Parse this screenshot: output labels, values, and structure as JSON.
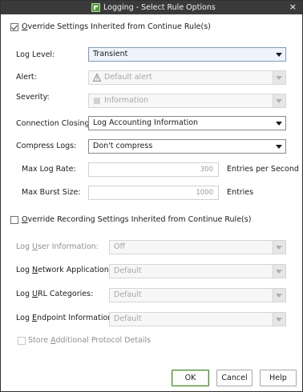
{
  "window": {
    "title": "Logging - Select Rule Options",
    "close_glyph": "×"
  },
  "override_settings": {
    "label_prefix": "O",
    "label_rest": "verride Settings Inherited from Continue Rule(s)",
    "checked": true
  },
  "log_level": {
    "label": "Log Level:",
    "value": "Transient"
  },
  "alert": {
    "label": "Alert:",
    "value": "Default alert",
    "icon": "warning-icon"
  },
  "severity": {
    "label": "Severity:",
    "value": "Information",
    "icon": "severity-icon"
  },
  "connection_closing": {
    "label": "Connection Closing:",
    "value": "Log Accounting Information"
  },
  "compress_logs": {
    "label": "Compress Logs:",
    "value": "Don't compress"
  },
  "max_log_rate": {
    "label": "Max Log Rate:",
    "value": "300",
    "unit": "Entries per Second"
  },
  "max_burst_size": {
    "label": "Max Burst Size:",
    "value": "1000",
    "unit": "Entries"
  },
  "override_recording": {
    "label_prefix": "O",
    "label_rest": "verride Recording Settings Inherited from Continue Rule(s)",
    "checked": false
  },
  "log_user_info": {
    "label_a": "Log ",
    "label_u": "U",
    "label_b": "ser Information:",
    "value": "Off"
  },
  "log_network_apps": {
    "label_a": "Log ",
    "label_u": "N",
    "label_b": "etwork Applications:",
    "value": "Default"
  },
  "log_url_categories": {
    "label_a": "Log ",
    "label_u": "U",
    "label_b": "RL Categories:",
    "value": "Default"
  },
  "log_endpoint_info": {
    "label_a": "Log ",
    "label_u": "E",
    "label_b": "ndpoint Information:",
    "value": "Default"
  },
  "store_additional": {
    "label_a": "Store ",
    "label_u": "A",
    "label_b": "dditional Protocol Details",
    "checked": false
  },
  "buttons": {
    "ok": "OK",
    "cancel": "Cancel",
    "help": "Help"
  }
}
